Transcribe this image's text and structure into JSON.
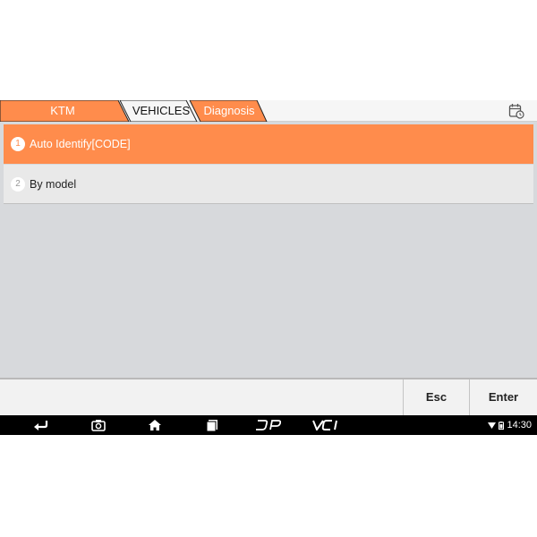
{
  "breadcrumb": {
    "items": [
      {
        "label": "KTM"
      },
      {
        "label": "VEHICLES"
      },
      {
        "label": "Diagnosis"
      }
    ]
  },
  "menu": {
    "items": [
      {
        "number": "1",
        "label": "Auto Identify[CODE]",
        "selected": true
      },
      {
        "number": "2",
        "label": "By model",
        "selected": false
      }
    ]
  },
  "toolbar": {
    "esc_label": "Esc",
    "enter_label": "Enter"
  },
  "navbar": {
    "dp_label": "DP",
    "vci_label": "VCI",
    "time": "14:30"
  },
  "colors": {
    "accent": "#ff8c4c",
    "background": "#d7d9dc"
  }
}
